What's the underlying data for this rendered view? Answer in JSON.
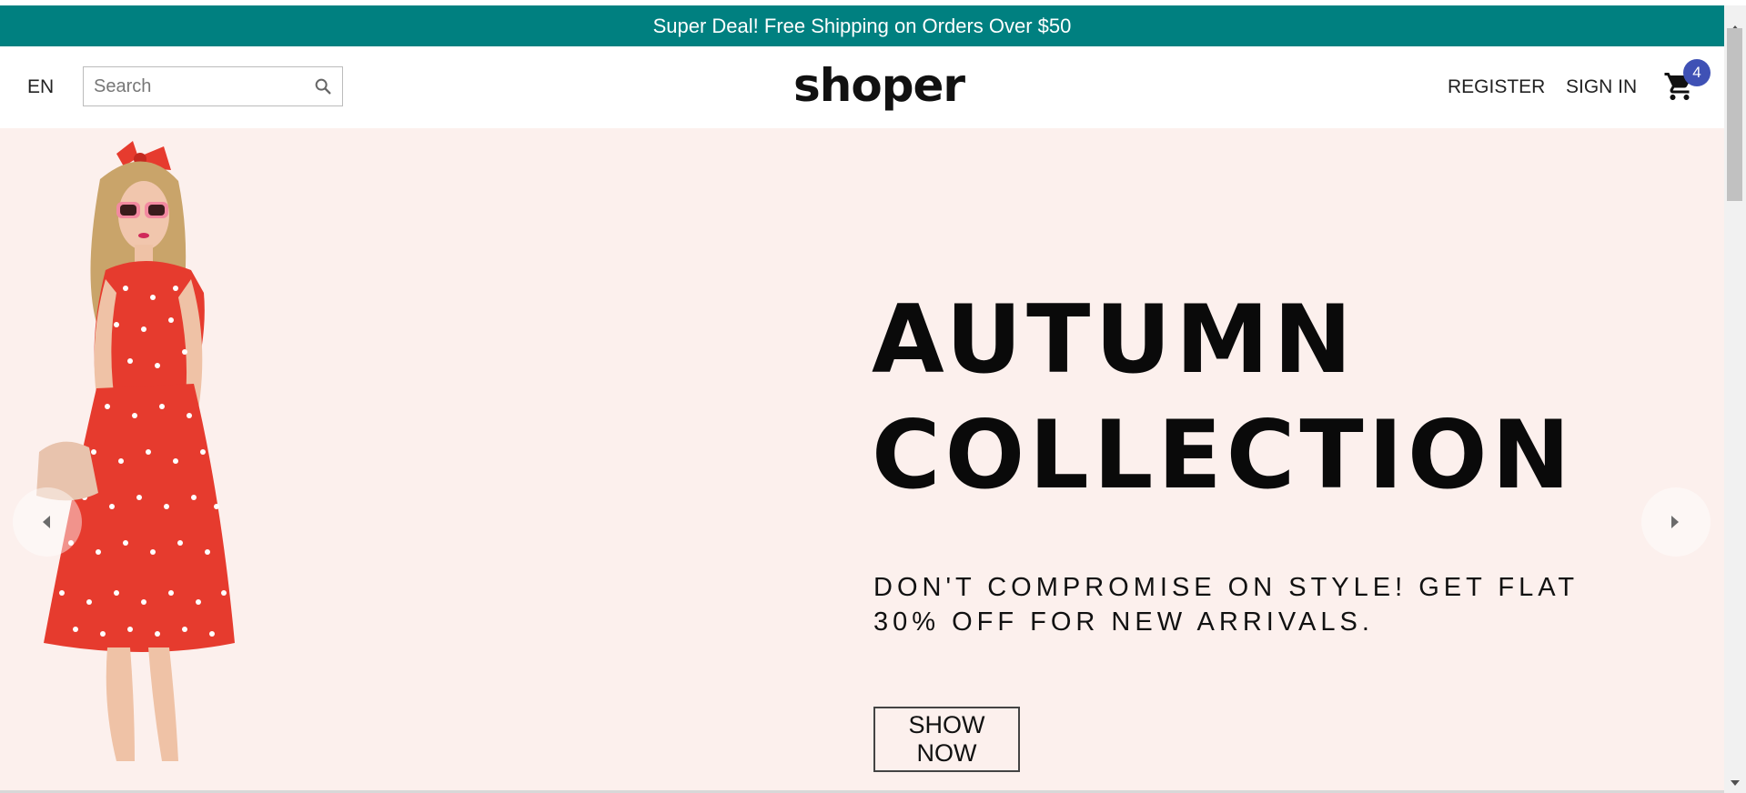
{
  "announcement": {
    "text": "Super Deal! Free Shipping on Orders Over $50"
  },
  "header": {
    "language": "EN",
    "search": {
      "placeholder": "Search",
      "value": ""
    },
    "logo": "shoper",
    "register_label": "REGISTER",
    "signin_label": "SIGN IN",
    "cart_count": "4"
  },
  "hero": {
    "title_line1": "AUTUMN",
    "title_line2": "COLLECTION",
    "subtitle": "DON'T COMPROMISE ON STYLE! GET FLAT 30% OFF FOR NEW ARRIVALS.",
    "button_label": "SHOW NOW"
  },
  "icons": {
    "search": "search-icon",
    "cart": "cart-icon",
    "prev": "chevron-left-icon",
    "next": "chevron-right-icon"
  },
  "colors": {
    "announcement_bg": "#008080",
    "hero_bg": "#fcf0ed",
    "badge_bg": "#3f51b5"
  }
}
